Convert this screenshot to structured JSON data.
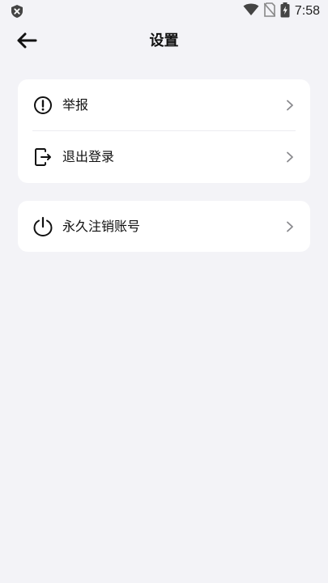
{
  "status_bar": {
    "time": "7:58",
    "left_icon": "shield-x-icon",
    "icons": [
      "wifi-icon",
      "no-sim-icon",
      "battery-charging-icon"
    ]
  },
  "header": {
    "title": "设置",
    "back_icon": "back-arrow-icon"
  },
  "groups": [
    {
      "items": [
        {
          "label": "举报",
          "icon": "exclamation-circle-icon"
        },
        {
          "label": "退出登录",
          "icon": "logout-icon"
        }
      ]
    },
    {
      "items": [
        {
          "label": "永久注销账号",
          "icon": "power-icon"
        }
      ]
    }
  ],
  "colors": {
    "background": "#f3f3f7",
    "card": "#ffffff",
    "text": "#111111",
    "chevron": "#8a8a8e"
  }
}
